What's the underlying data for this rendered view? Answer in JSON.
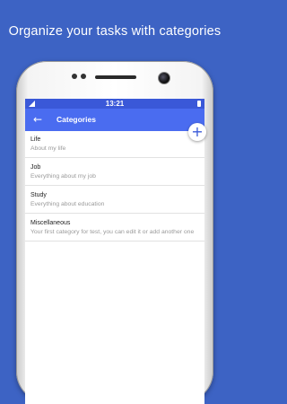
{
  "headline": "Organize your tasks with categories",
  "status": {
    "time": "13:21"
  },
  "toolbar": {
    "title": "Categories",
    "back_icon": "arrow-left-icon"
  },
  "fab": {
    "icon": "plus-icon",
    "label": "+"
  },
  "categories": [
    {
      "name": "Life",
      "description": "About my life"
    },
    {
      "name": "Job",
      "description": "Everything about my job"
    },
    {
      "name": "Study",
      "description": "Everything about education"
    },
    {
      "name": "Miscellaneous",
      "description": "Your first category for test, you can edit it or add another one"
    }
  ],
  "colors": {
    "background": "#3d63c4",
    "toolbar": "#4a6cf0",
    "statusbar": "#3a58d8"
  }
}
